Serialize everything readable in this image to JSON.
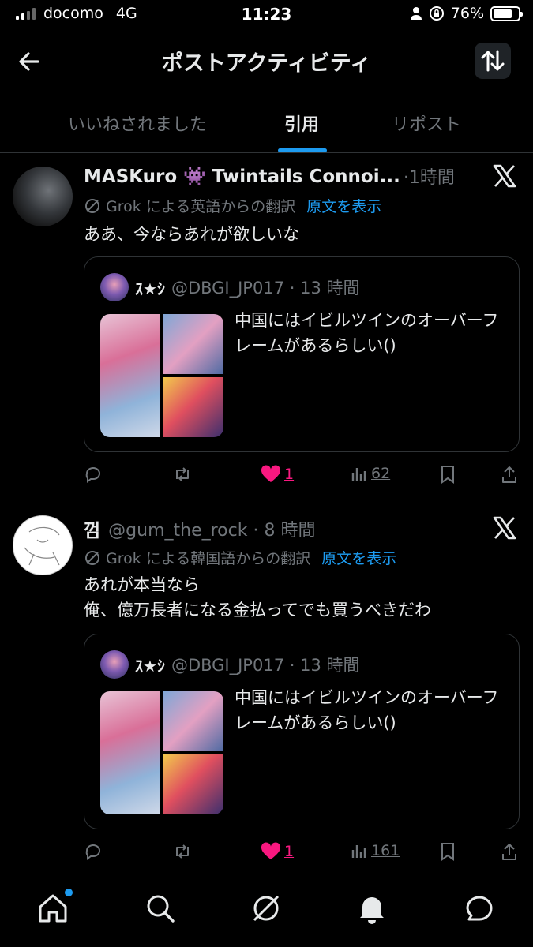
{
  "status_bar": {
    "carrier": "docomo",
    "network": "4G",
    "time": "11:23",
    "battery": "76%",
    "battery_level": 0.76
  },
  "header": {
    "title": "ポストアクティビティ",
    "back_icon": "back-arrow-icon",
    "sort_icon": "sort-arrows-icon"
  },
  "tabs": [
    {
      "label": "いいねされました",
      "active": false
    },
    {
      "label": "引用",
      "active": true
    },
    {
      "label": "リポスト",
      "active": false
    }
  ],
  "posts": [
    {
      "name": "MASKuro 👾 Twintails Connoi...",
      "meta": "·1時間",
      "translation": "Grok による英語からの翻訳",
      "show_original": "原文を表示",
      "text": [
        "ああ、今ならあれが欲しいな"
      ],
      "quote": {
        "name": "ｽ★ｼ",
        "meta": "@DBGI_JP017 · 13 時間",
        "text": "中国にはイビルツインのオーバーフレームがあるらしい()"
      },
      "likes": "1",
      "views": "62"
    },
    {
      "name": "껌",
      "meta": "@gum_the_rock · 8 時間",
      "translation": "Grok による韓国語からの翻訳",
      "show_original": "原文を表示",
      "text": [
        "あれが本当なら",
        "俺、億万長者になる金払ってでも買うべきだわ"
      ],
      "quote": {
        "name": "ｽ★ｼ",
        "meta": "@DBGI_JP017 · 13 時間",
        "text": "中国にはイビルツインのオーバーフレームがあるらしい()"
      },
      "likes": "1",
      "views": "161"
    }
  ],
  "colors": {
    "accent": "#1d9bf0",
    "like": "#f91880",
    "muted": "#71767b",
    "background": "#000000"
  },
  "bottom_nav": [
    "home-icon",
    "search-icon",
    "grok-icon",
    "notifications-icon",
    "messages-icon"
  ]
}
